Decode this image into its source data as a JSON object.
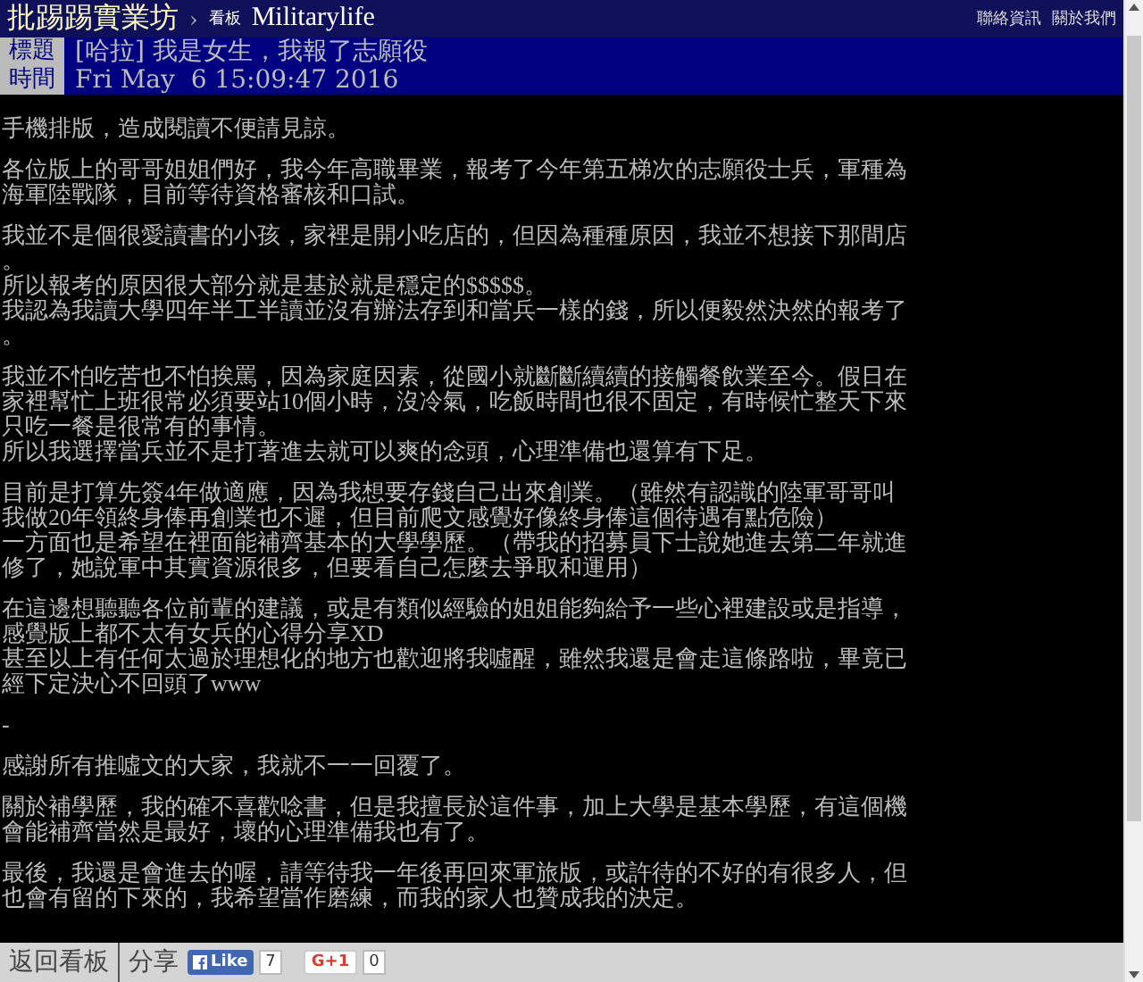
{
  "header": {
    "site": "批踢踢實業坊",
    "separator": "›",
    "board_label": "看板",
    "board": "Militarylife",
    "links": [
      "聯絡資訊",
      "關於我們"
    ]
  },
  "meta": [
    {
      "label": "標題",
      "value": "[哈拉] 我是女生，我報了志願役"
    },
    {
      "label": "時間",
      "value": "Fri May  6 15:09:47 2016"
    }
  ],
  "paragraphs": [
    [
      "手機排版，造成閱讀不便請見諒。"
    ],
    [
      "各位版上的哥哥姐姐們好，我今年高職畢業，報考了今年第五梯次的志願役士兵，軍種為海軍陸戰隊，目前等待資格審核和口試。"
    ],
    [
      "我並不是個很愛讀書的小孩，家裡是開小吃店的，但因為種種原因，我並不想接下那間店。",
      "所以報考的原因很大部分就是基於就是穩定的$$$$$。",
      "我認為我讀大學四年半工半讀並沒有辦法存到和當兵一樣的錢，所以便毅然決然的報考了。"
    ],
    [
      "我並不怕吃苦也不怕挨罵，因為家庭因素，從國小就斷斷續續的接觸餐飲業至今。假日在家裡幫忙上班很常必須要站10個小時，沒冷氣，吃飯時間也很不固定，有時候忙整天下來只吃一餐是很常有的事情。",
      "所以我選擇當兵並不是打著進去就可以爽的念頭，心理準備也還算有下足。"
    ],
    [
      "目前是打算先簽4年做適應，因為我想要存錢自己出來創業。（雖然有認識的陸軍哥哥叫我做20年領終身俸再創業也不遲，但目前爬文感覺好像終身俸這個待遇有點危險）",
      "一方面也是希望在裡面能補齊基本的大學學歷。（帶我的招募員下士說她進去第二年就進修了，她說軍中其實資源很多，但要看自己怎麼去爭取和運用）"
    ],
    [
      "在這邊想聽聽各位前輩的建議，或是有類似經驗的姐姐能夠給予一些心裡建設或是指導，感覺版上都不太有女兵的心得分享XD",
      "甚至以上有任何太過於理想化的地方也歡迎將我噓醒，雖然我還是會走這條路啦，畢竟已經下定決心不回頭了www"
    ],
    [
      "-"
    ],
    [
      "感謝所有推噓文的大家，我就不一一回覆了。"
    ],
    [
      "關於補學歷，我的確不喜歡唸書，但是我擅長於這件事，加上大學是基本學歷，有這個機會能補齊當然是最好，壞的心理準備我也有了。"
    ],
    [
      "最後，我還是會進去的喔，請等待我一年後再回來軍旅版，或許待的不好的有很多人，但也會有留的下來的，我希望當作磨練，而我的家人也贊成我的決定。"
    ]
  ],
  "footer": {
    "back": "返回看板",
    "share": "分享",
    "like": "Like",
    "like_count": "7",
    "plus": "G+1",
    "plus_count": "0"
  }
}
